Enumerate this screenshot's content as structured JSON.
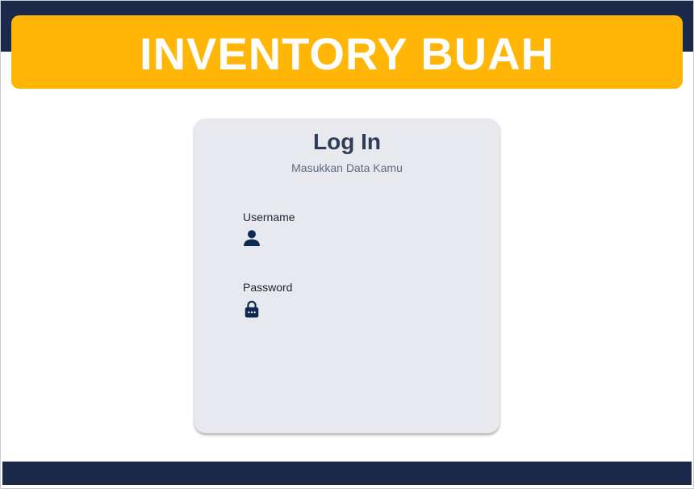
{
  "header": {
    "title": "INVENTORY BUAH"
  },
  "login": {
    "title": "Log In",
    "subtitle": "Masukkan Data Kamu",
    "username": {
      "label": "Username",
      "value": "",
      "placeholder": "",
      "icon": "user-icon"
    },
    "password": {
      "label": "Password",
      "value": "",
      "placeholder": "",
      "icon": "lock-icon"
    }
  },
  "colors": {
    "dark_bar": "#1b2a4a",
    "banner": "#ffb606",
    "card": "#e8e9ee",
    "icon": "#0e2a52"
  }
}
